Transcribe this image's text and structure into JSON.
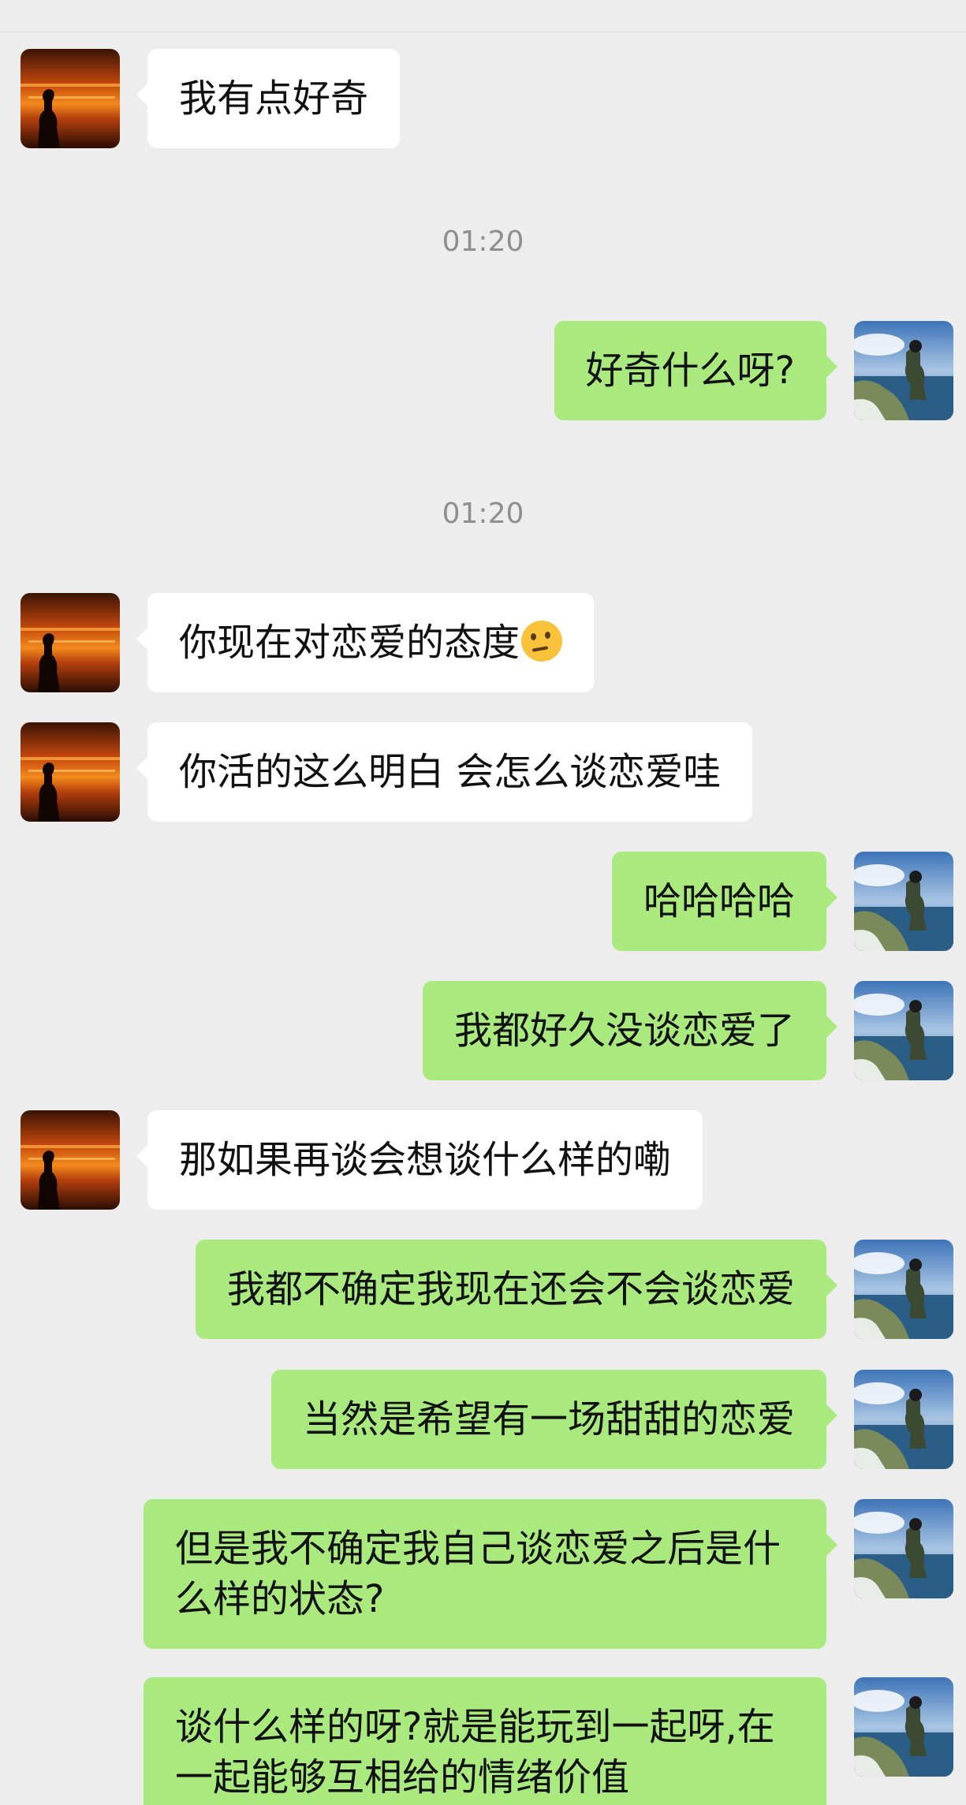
{
  "timestamps": [
    "01:20",
    "01:20"
  ],
  "avatars": {
    "contact": "sunset-avatar-icon",
    "self": "cliff-avatar-icon"
  },
  "messages": [
    {
      "from": "contact",
      "text": "我有点好奇"
    },
    {
      "from": "self",
      "text": "好奇什么呀?"
    },
    {
      "from": "contact",
      "text": "你现在对恋爱的态度",
      "emoji": "thinking-face-icon"
    },
    {
      "from": "contact",
      "text": "你活的这么明白 会怎么谈恋爱哇"
    },
    {
      "from": "self",
      "text": "哈哈哈哈"
    },
    {
      "from": "self",
      "text": "我都好久没谈恋爱了"
    },
    {
      "from": "contact",
      "text": "那如果再谈会想谈什么样的嘞"
    },
    {
      "from": "self",
      "text": "我都不确定我现在还会不会谈恋爱"
    },
    {
      "from": "self",
      "text": "当然是希望有一场甜甜的恋爱"
    },
    {
      "from": "self",
      "text": "但是我不确定我自己谈恋爱之后是什么样的状态?"
    },
    {
      "from": "self",
      "text": "谈什么样的呀?就是能玩到一起呀,在一起能够互相给的情绪价值"
    }
  ],
  "colors": {
    "background": "#ededed",
    "incoming_bubble": "#ffffff",
    "outgoing_bubble": "#a9e97e"
  }
}
